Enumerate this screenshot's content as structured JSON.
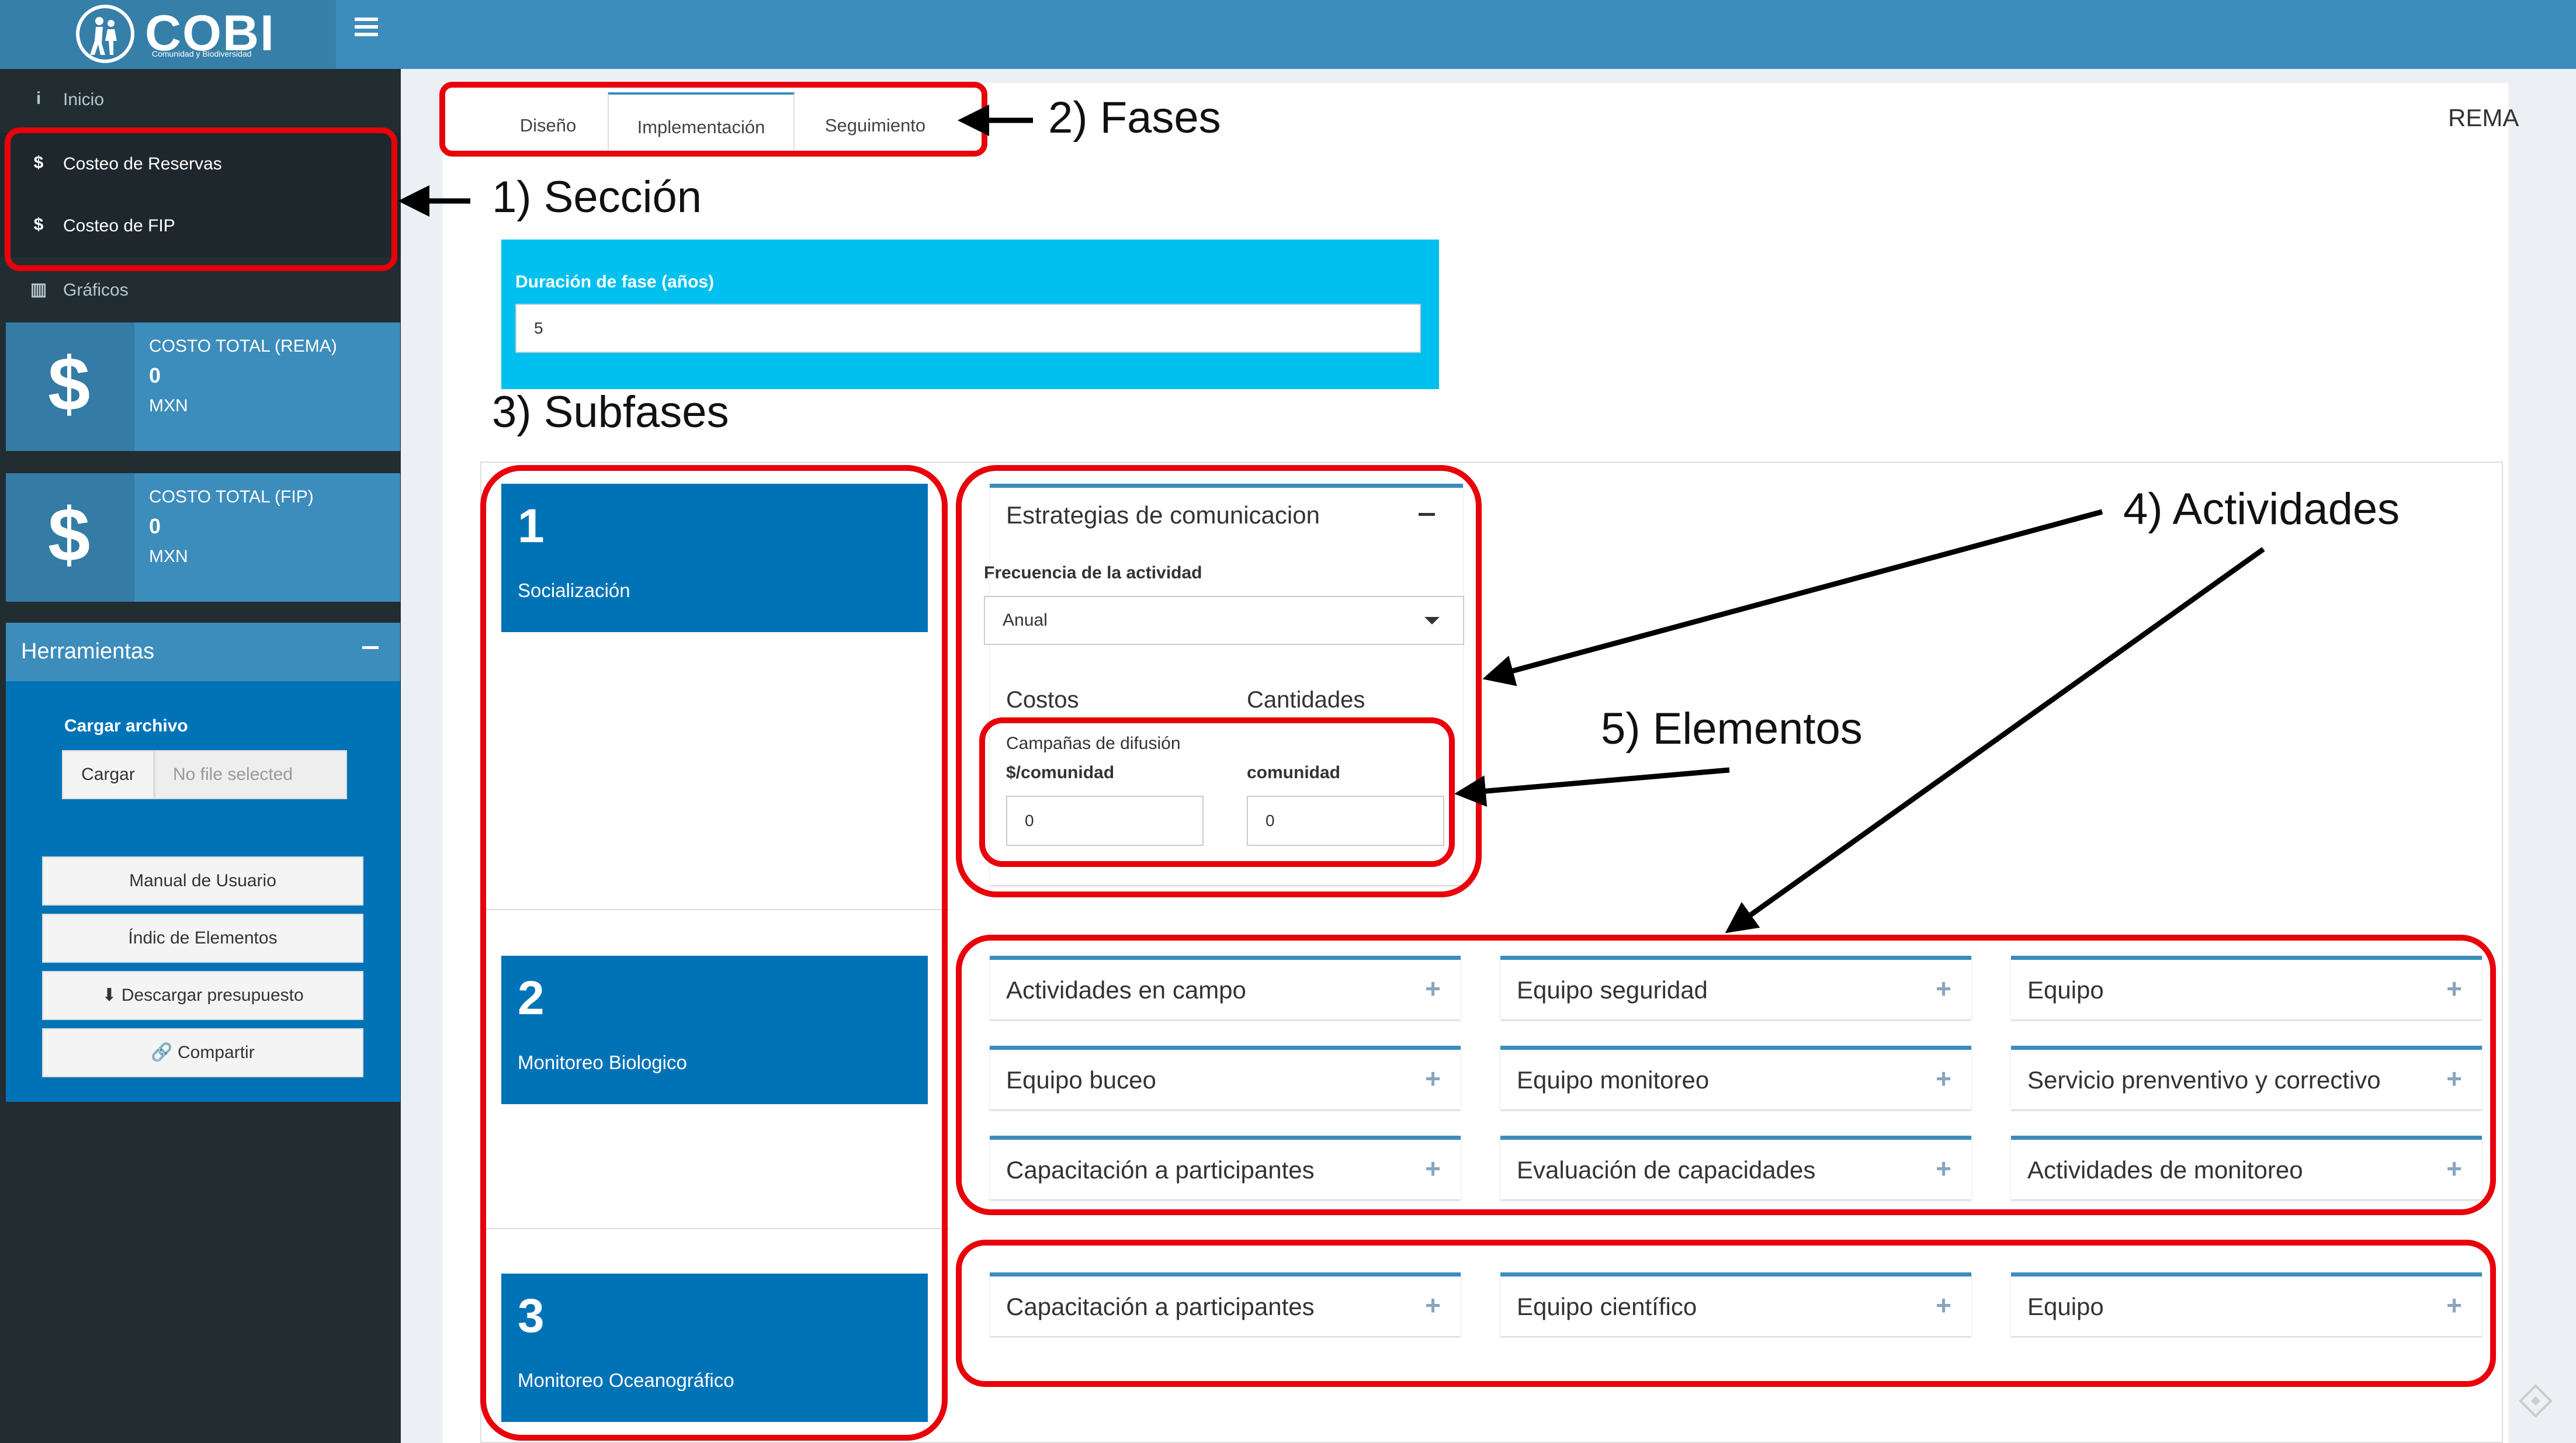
{
  "header": {
    "logo_text": "COBI",
    "logo_subtitle": "Comunidad y Biodiversidad"
  },
  "sidebar": {
    "items": [
      {
        "icon": "info-icon",
        "glyph": "i",
        "label": "Inicio"
      },
      {
        "icon": "dollar-icon",
        "glyph": "$",
        "label": "Costeo de Reservas"
      },
      {
        "icon": "dollar-icon",
        "glyph": "$",
        "label": "Costeo de FIP"
      },
      {
        "icon": "bar-chart-icon",
        "glyph": "▥",
        "label": "Gráficos"
      }
    ],
    "value_boxes": [
      {
        "title": "COSTO TOTAL (REMA)",
        "value": "0",
        "unit": "MXN"
      },
      {
        "title": "COSTO TOTAL (FIP)",
        "value": "0",
        "unit": "MXN"
      }
    ],
    "tools": {
      "title": "Herramientas",
      "upload_label": "Cargar archivo",
      "upload_button": "Cargar",
      "upload_placeholder": "No file selected",
      "buttons": [
        "Manual de Usuario",
        "Índic de Elementos",
        "Descargar presupuesto",
        "Compartir"
      ]
    }
  },
  "main": {
    "tabs": [
      "Diseño",
      "Implementación",
      "Seguimiento"
    ],
    "active_tab": "Implementación",
    "context_label": "REMA",
    "duration": {
      "label": "Duración de fase (años)",
      "value": "5"
    },
    "subfases": [
      {
        "number": "1",
        "name": "Socialización"
      },
      {
        "number": "2",
        "name": "Monitoreo Biologico"
      },
      {
        "number": "3",
        "name": "Monitoreo Oceanográfico"
      }
    ],
    "open_activity": {
      "title": "Estrategias de comunicacion",
      "frequency_label": "Frecuencia de la actividad",
      "frequency_value": "Anual",
      "costos_header": "Costos",
      "cantidades_header": "Cantidades",
      "element_name": "Campañas de difusión",
      "cost_unit": "$/comunidad",
      "cost_value": "0",
      "qty_unit": "comunidad",
      "qty_value": "0"
    },
    "subfase2_activities": [
      "Actividades en campo",
      "Equipo seguridad",
      "Equipo",
      "Equipo buceo",
      "Equipo monitoreo",
      "Servicio prenventivo y correctivo",
      "Capacitación a participantes",
      "Evaluación de capacidades",
      "Actividades de monitoreo"
    ],
    "subfase3_activities": [
      "Capacitación a participantes",
      "Equipo científico",
      "Equipo"
    ]
  },
  "annotations": {
    "seccion": "1) Sección",
    "fases": "2) Fases",
    "subfases": "3) Subfases",
    "actividades": "4) Actividades",
    "elementos": "5) Elementos",
    "color": "#e8000b"
  },
  "colors": {
    "header": "#3c8dbc",
    "sidebar": "#222d32",
    "primary": "#0073b7",
    "info": "#00c0ef",
    "annotation": "#e8000b"
  }
}
